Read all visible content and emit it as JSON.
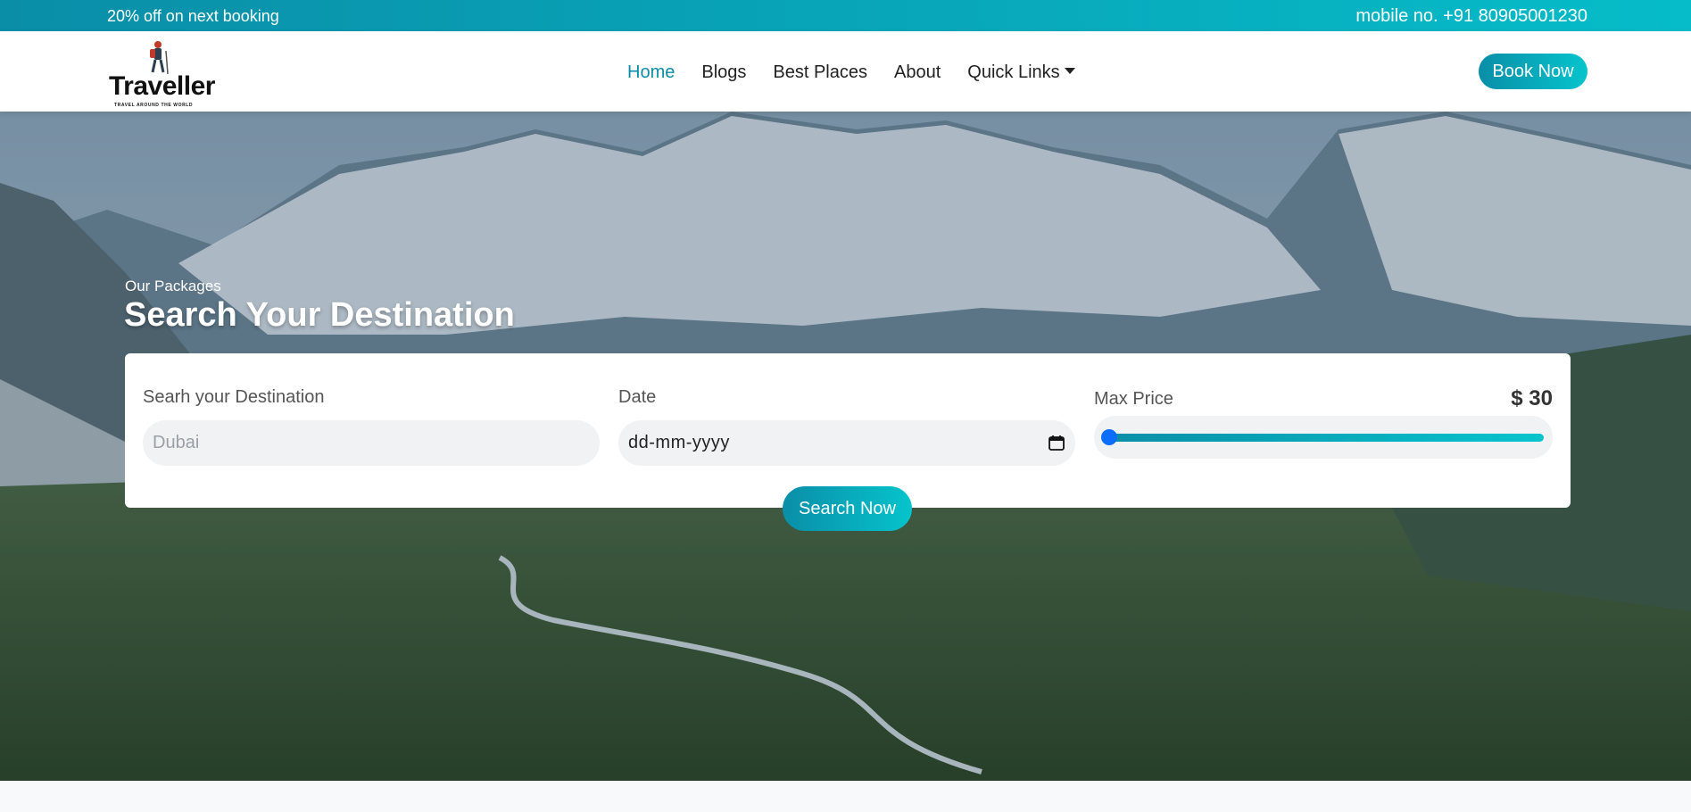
{
  "topbar": {
    "promo": "20% off on next booking",
    "contact": "mobile no. +91 80905001230"
  },
  "logo": {
    "brand": "Traveller",
    "tagline": "TRAVEL AROUND THE WORLD"
  },
  "nav": {
    "items": [
      {
        "label": "Home",
        "active": true
      },
      {
        "label": "Blogs"
      },
      {
        "label": "Best Places"
      },
      {
        "label": "About"
      },
      {
        "label": "Quick Links",
        "dropdown": true
      }
    ],
    "cta": "Book Now"
  },
  "hero": {
    "subtitle": "Our Packages",
    "title": "Search Your Destination"
  },
  "search": {
    "destination_label": "Searh your Destination",
    "destination_placeholder": "Dubai",
    "date_label": "Date",
    "date_value": "dd-mm-yyyy",
    "price_label": "Max Price",
    "price_value": "$ 30",
    "price_slider_fraction": 0.0,
    "submit": "Search Now"
  },
  "colors": {
    "accent_start": "#0a8ea8",
    "accent_end": "#06c4cc",
    "slider_thumb": "#0d6efd",
    "active_link": "#0a8ea8"
  },
  "icons": [
    "hiker-icon",
    "caret-down-icon",
    "calendar-icon"
  ]
}
